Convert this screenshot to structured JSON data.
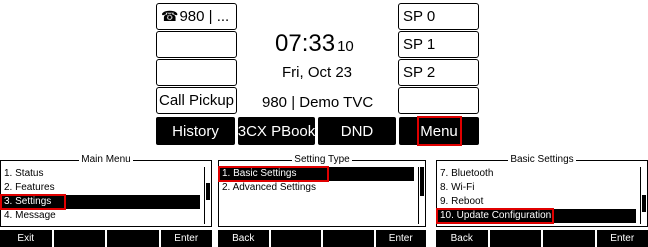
{
  "phone": {
    "left_keys": [
      {
        "icon": "phone-icon",
        "glyph": "☎",
        "label": "980 | ..."
      },
      {
        "label": ""
      },
      {
        "label": ""
      },
      {
        "label": "Call Pickup"
      }
    ],
    "right_keys": [
      {
        "label": "SP 0"
      },
      {
        "label": "SP 1"
      },
      {
        "label": "SP 2"
      },
      {
        "label": ""
      }
    ],
    "time": "07:33",
    "seconds": "10",
    "date": "Fri, Oct 23",
    "extension": "980 | Demo TVC",
    "softkeys": [
      "History",
      "3CX PBook",
      "DND",
      "Menu"
    ]
  },
  "panels": [
    {
      "title": "Main Menu",
      "items": [
        "1. Status",
        "2. Features",
        "3. Settings",
        "4. Message"
      ],
      "selected_index": 2,
      "scroll_thumb": {
        "position": 0.4,
        "size": 0.3
      },
      "softkeys": [
        "Exit",
        "",
        "",
        "Enter"
      ]
    },
    {
      "title": "Setting Type",
      "items": [
        "1. Basic Settings",
        "2. Advanced Settings"
      ],
      "selected_index": 0,
      "scroll_thumb": {
        "position": 0.0,
        "size": 0.5
      },
      "softkeys": [
        "Back",
        "",
        "",
        "Enter"
      ]
    },
    {
      "title": "Basic Settings",
      "items": [
        "7. Bluetooth",
        "8. Wi-Fi",
        "9. Reboot",
        "10. Update Configuration"
      ],
      "selected_index": 3,
      "scroll_thumb": {
        "position": 0.7,
        "size": 0.3
      },
      "softkeys": [
        "Back",
        "",
        "",
        "Enter"
      ]
    }
  ],
  "highlight_color": "#e00000"
}
